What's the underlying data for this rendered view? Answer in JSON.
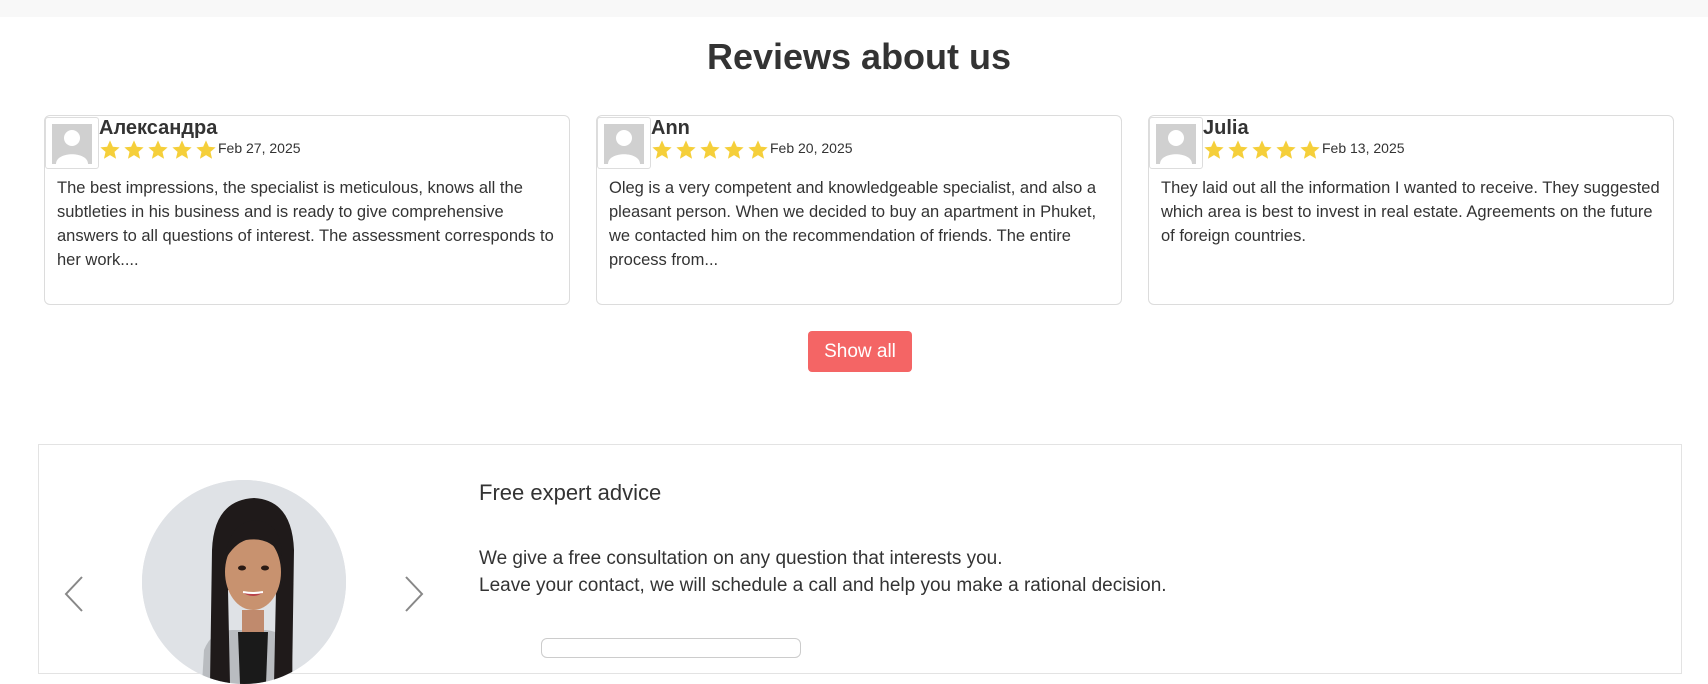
{
  "section_title": "Reviews about us",
  "star_color": "#f5cf3a",
  "accent_color": "#f46565",
  "reviews": [
    {
      "name": "Александра",
      "rating": 5,
      "date": "Feb 27, 2025",
      "text": "The best impressions, the specialist is meticulous, knows all the subtleties in his business and is ready to give comprehensive answers to all questions of interest. The assessment corresponds to her work...."
    },
    {
      "name": "Ann",
      "rating": 5,
      "date": "Feb 20, 2025",
      "text": "Oleg is a very competent and knowledgeable specialist, and also a pleasant person. When we decided to buy an apartment in Phuket, we contacted him on the recommendation of friends. The entire process from..."
    },
    {
      "name": "Julia",
      "rating": 5,
      "date": "Feb 13, 2025",
      "text": "They laid out all the information I wanted to receive. They suggested which area is best to invest in real estate. Agreements on the future of foreign countries."
    }
  ],
  "show_all_label": "Show all",
  "advice": {
    "title": "Free expert advice",
    "line1": "We give a free consultation on any question that interests you.",
    "line2": "Leave your contact, we will schedule a call and help you make a rational decision.",
    "prev_icon": "chevron-left-icon",
    "next_icon": "chevron-right-icon"
  }
}
